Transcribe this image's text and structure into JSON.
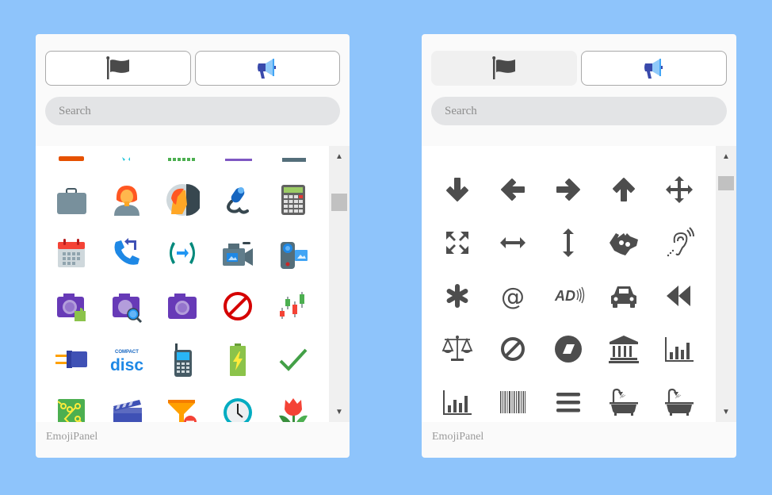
{
  "panels": [
    {
      "id": "left",
      "active_tab": "symbols",
      "tabs": [
        {
          "name": "flags",
          "icon": "flag-icon"
        },
        {
          "name": "symbols",
          "icon": "megaphone-icon"
        }
      ],
      "search": {
        "placeholder": "Search",
        "value": ""
      },
      "icons": [
        "partially-hidden-orange",
        "partially-hidden-cyan",
        "partially-hidden-green",
        "partially-hidden-purple",
        "partially-hidden-slate",
        "briefcase",
        "woman-avatar",
        "profile-side-face",
        "usb-cable-plug",
        "calculator",
        "calendar",
        "phone-callback",
        "phone-call-transfer",
        "video-camera",
        "camcorder",
        "camera-addon",
        "camera-search",
        "camera",
        "no-entry-sign",
        "candlestick-chart",
        "usb-connector",
        "compact-disc-logo",
        "mobile-phone",
        "charging-battery",
        "checkmark",
        "circuit-board",
        "clapperboard",
        "filter-remove",
        "clock",
        "tulip"
      ],
      "footer": "EmojiPanel"
    },
    {
      "id": "right",
      "active_tab": "flags",
      "tabs": [
        {
          "name": "flags",
          "icon": "flag-icon"
        },
        {
          "name": "symbols",
          "icon": "megaphone-icon"
        }
      ],
      "search": {
        "placeholder": "Search",
        "value": ""
      },
      "icons": [
        "arrow-down",
        "arrow-left",
        "arrow-right",
        "arrow-up",
        "arrows-move",
        "expand-arrows",
        "arrows-horizontal",
        "arrows-vertical",
        "sign-language",
        "assistive-listening",
        "asterisk",
        "at-sign",
        "audio-description",
        "car",
        "backward",
        "balance-scale",
        "ban",
        "stop-circle",
        "bank",
        "bar-chart",
        "bar-chart-alt",
        "barcode",
        "bars",
        "bathtub",
        "bath"
      ],
      "footer": "EmojiPanel"
    }
  ],
  "colors": {
    "background": "#8ec4fb",
    "icon_gray": "#4d4d4d"
  }
}
